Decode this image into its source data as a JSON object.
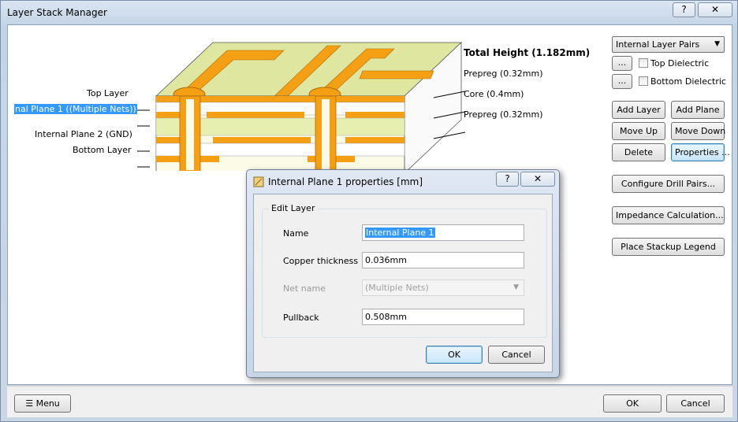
{
  "window": {
    "title": "Layer Stack Manager",
    "help_label": "?",
    "close_label": "✕"
  },
  "diagram": {
    "total_height": "Total Height (1.182mm)",
    "left_labels": {
      "top_layer": "Top Layer",
      "plane1": "nal Plane 1 ((Multiple Nets))",
      "plane2": "Internal Plane 2 (GND)",
      "bottom_layer": "Bottom Layer"
    },
    "right_labels": {
      "prepreg_top": "Prepreg (0.32mm)",
      "core": "Core (0.4mm)",
      "prepreg_bottom": "Prepreg (0.32mm)"
    },
    "colors": {
      "copper": "#f5a014",
      "dielectric": "#f0f0b8",
      "core": "#e7efb0"
    }
  },
  "right_panel": {
    "pairs_select": "Internal Layer Pairs",
    "ellipsis": "...",
    "top_dielectric": "Top Dielectric",
    "bottom_dielectric": "Bottom Dielectric",
    "add_layer": "Add Layer",
    "add_plane": "Add Plane",
    "move_up": "Move Up",
    "move_down": "Move Down",
    "delete": "Delete",
    "properties": "Properties ...",
    "configure_drill": "Configure Drill Pairs...",
    "impedance": "Impedance Calculation...",
    "place_legend": "Place Stackup Legend"
  },
  "footer": {
    "menu": "Menu",
    "ok": "OK",
    "cancel": "Cancel"
  },
  "dialog": {
    "title": "Internal Plane 1 properties [mm]",
    "help_label": "?",
    "close_label": "✕",
    "group_title": "Edit Layer",
    "name_label": "Name",
    "name_value": "Internal Plane 1",
    "copper_label": "Copper thickness",
    "copper_value": "0.036mm",
    "net_label": "Net name",
    "net_value": "(Multiple Nets)",
    "pullback_label": "Pullback",
    "pullback_value": "0.508mm",
    "ok": "OK",
    "cancel": "Cancel"
  }
}
